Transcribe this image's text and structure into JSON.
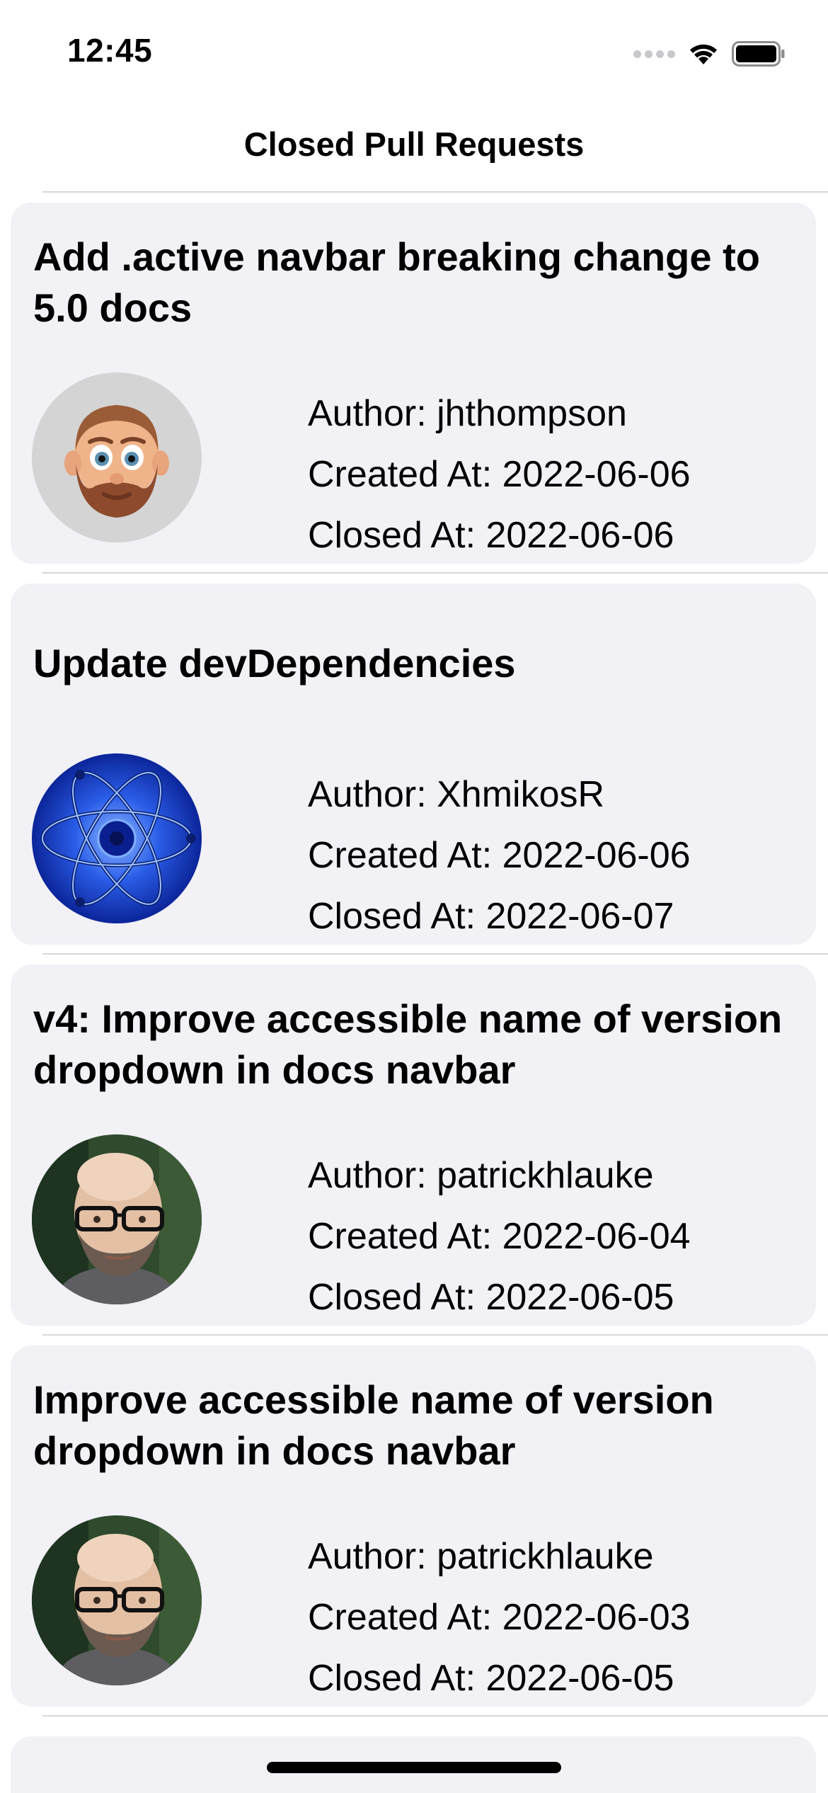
{
  "status_bar": {
    "time": "12:45"
  },
  "nav": {
    "title": "Closed Pull Requests"
  },
  "pull_requests": [
    {
      "title": "Add .active navbar breaking change to 5.0 docs",
      "author": "Author: jhthompson",
      "created": "Created At: 2022-06-06",
      "closed": "Closed At: 2022-06-06",
      "avatar_icon": "memoji-avatar"
    },
    {
      "title": "Update devDependencies",
      "author": "Author: XhmikosR",
      "created": "Created At: 2022-06-06",
      "closed": "Closed At: 2022-06-07",
      "avatar_icon": "atom-avatar"
    },
    {
      "title": "v4: Improve accessible name of version dropdown in docs navbar",
      "author": "Author: patrickhlauke",
      "created": "Created At: 2022-06-04",
      "closed": "Closed At: 2022-06-05",
      "avatar_icon": "photo-avatar"
    },
    {
      "title": "Improve accessible name of version dropdown in docs navbar",
      "author": "Author: patrickhlauke",
      "created": "Created At: 2022-06-03",
      "closed": "Closed At: 2022-06-05",
      "avatar_icon": "photo-avatar"
    }
  ]
}
